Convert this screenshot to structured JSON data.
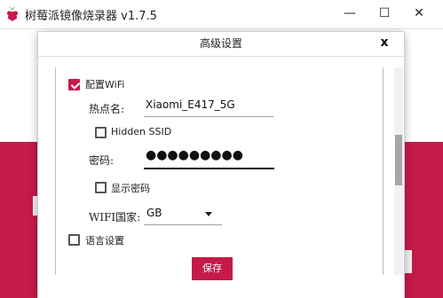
{
  "app": {
    "title": "树莓派镜像烧录器 v1.7.5",
    "window_controls": {
      "minimize": "—",
      "maximize": "☐",
      "close": "✕"
    }
  },
  "dialog": {
    "title": "高级设置",
    "close_label": "x",
    "wifi": {
      "checkbox_label": "配置WiFi",
      "checked": true,
      "ssid_label": "热点名:",
      "ssid_value": "Xiaomi_E417_5G",
      "hidden_ssid_label": "Hidden SSID",
      "hidden_ssid_checked": false,
      "password_label": "密码:",
      "password_value": "●●●●●●●●●",
      "show_password_label": "显示密码",
      "show_password_checked": false,
      "country_label": "WIFI国家:",
      "country_value": "GB"
    },
    "locale": {
      "checkbox_label": "语言设置",
      "checked": false
    },
    "save_label": "保存"
  },
  "colors": {
    "accent": "#c51a4a"
  },
  "icons": [
    "raspberry-logo-icon",
    "chevron-down-icon"
  ]
}
